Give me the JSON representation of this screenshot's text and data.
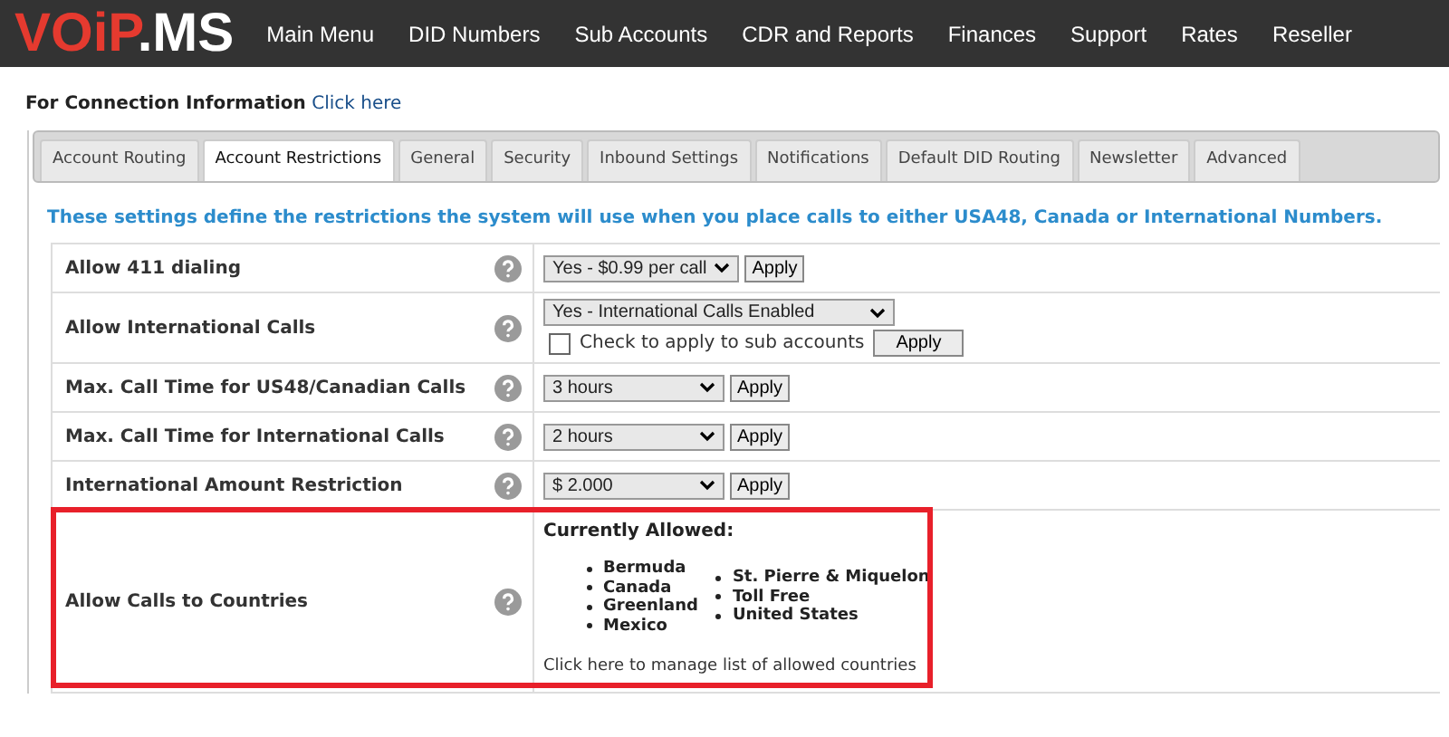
{
  "logo": {
    "main": "VOiP",
    "suffix": ".MS"
  },
  "nav": [
    "Main Menu",
    "DID Numbers",
    "Sub Accounts",
    "CDR and Reports",
    "Finances",
    "Support",
    "Rates",
    "Reseller"
  ],
  "connection": {
    "label": "For Connection Information",
    "link": "Click here"
  },
  "tabs": [
    {
      "label": "Account Routing",
      "selected": false
    },
    {
      "label": "Account Restrictions",
      "selected": true
    },
    {
      "label": "General",
      "selected": false
    },
    {
      "label": "Security",
      "selected": false
    },
    {
      "label": "Inbound Settings",
      "selected": false
    },
    {
      "label": "Notifications",
      "selected": false
    },
    {
      "label": "Default DID Routing",
      "selected": false
    },
    {
      "label": "Newsletter",
      "selected": false
    },
    {
      "label": "Advanced",
      "selected": false
    }
  ],
  "intro": "These settings define the restrictions the system will use when you place calls to either USA48, Canada or International Numbers.",
  "rows": [
    {
      "kind": "select",
      "label": "Allow 411 dialing",
      "value": "Yes - $0.99 per call",
      "apply": "Apply"
    },
    {
      "kind": "select_check",
      "label": "Allow International Calls",
      "value": "Yes - International Calls Enabled",
      "check_label": "Check to apply to sub accounts",
      "checked": false,
      "apply": "Apply"
    },
    {
      "kind": "select",
      "label": "Max. Call Time for US48/Canadian Calls",
      "value": "3 hours",
      "apply": "Apply"
    },
    {
      "kind": "select",
      "label": "Max. Call Time for International Calls",
      "value": "2 hours",
      "apply": "Apply"
    },
    {
      "kind": "select",
      "label": "International Amount Restriction",
      "value": "$ 2.000",
      "apply": "Apply"
    },
    {
      "kind": "countries",
      "label": "Allow Calls to Countries",
      "highlighted": true,
      "heading": "Currently Allowed:",
      "columns": [
        [
          "Bermuda",
          "Canada",
          "Greenland",
          "Mexico"
        ],
        [
          "St. Pierre & Miquelon",
          "Toll Free",
          "United States"
        ]
      ],
      "link": "Click here to manage list of allowed countries"
    }
  ]
}
